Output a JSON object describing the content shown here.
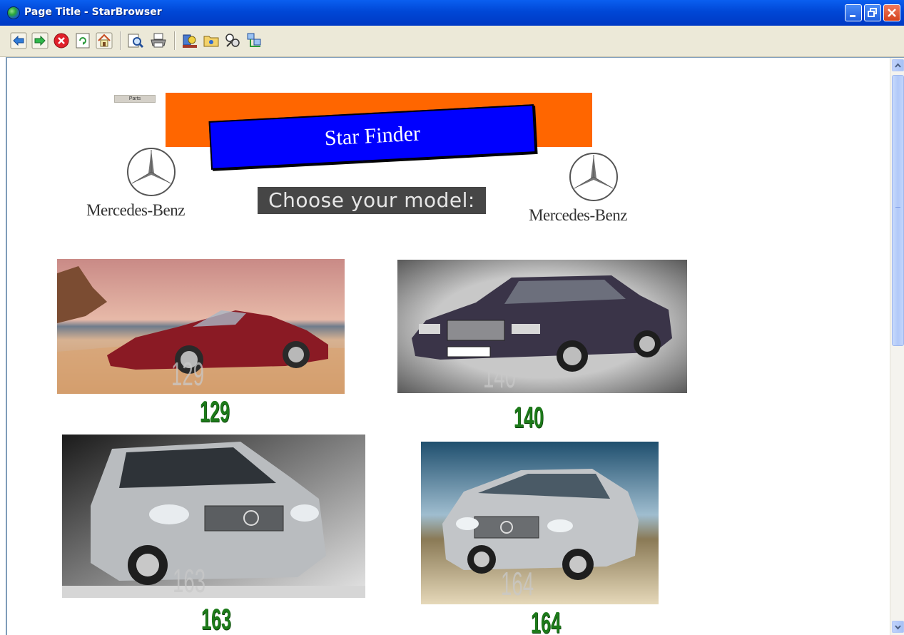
{
  "window": {
    "title": "Page Title - StarBrowser"
  },
  "toolbar": {
    "buttons": [
      {
        "name": "back-icon"
      },
      {
        "name": "forward-icon"
      },
      {
        "name": "stop-icon"
      },
      {
        "name": "refresh-icon"
      },
      {
        "name": "home-icon"
      },
      {
        "name": "search-icon"
      },
      {
        "name": "print-icon"
      },
      {
        "name": "tools-icon"
      },
      {
        "name": "folder-icon"
      },
      {
        "name": "settings-icon"
      },
      {
        "name": "network-icon"
      }
    ]
  },
  "page": {
    "parts_button": "Parts",
    "banner_title": "Star Finder",
    "choose_text": "Choose your model:",
    "brand_left": "Mercedes-Benz",
    "brand_right": "Mercedes-Benz",
    "models": [
      {
        "id": "129",
        "label": "129",
        "overlay": "129",
        "body_color": "#8a1a24"
      },
      {
        "id": "140",
        "label": "140",
        "overlay": "140",
        "body_color": "#3a3448"
      },
      {
        "id": "163",
        "label": "163",
        "overlay": "163",
        "body_color": "#b9bcbf"
      },
      {
        "id": "164",
        "label": "164",
        "overlay": "164",
        "body_color": "#c2c5c8"
      }
    ]
  },
  "colors": {
    "orange_band": "#ff6600",
    "blue_banner": "#0000ff",
    "model_label": "#1d7a1a",
    "titlebar": "#0047d6"
  }
}
